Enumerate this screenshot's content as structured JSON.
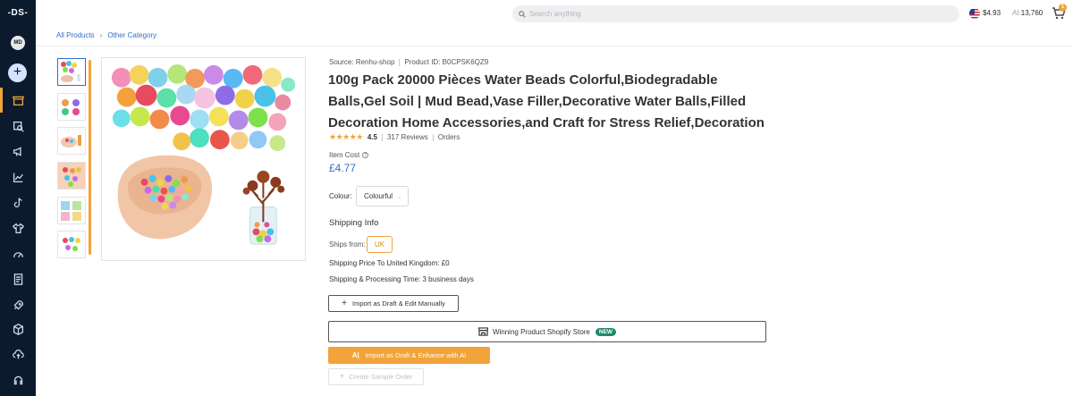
{
  "app": {
    "logo_text": "-DS-",
    "user_initials": "MD",
    "add_label": "+"
  },
  "sidebar": {
    "items": [
      {
        "icon": "store-icon",
        "active": true
      },
      {
        "icon": "product-search-icon",
        "active": false
      },
      {
        "icon": "megaphone-icon",
        "active": false
      },
      {
        "icon": "analytics-icon",
        "active": false
      },
      {
        "icon": "tiktok-icon",
        "active": false
      },
      {
        "icon": "shirt-icon",
        "active": false
      },
      {
        "icon": "speedometer-icon",
        "active": false
      },
      {
        "icon": "orders-icon",
        "active": false
      },
      {
        "icon": "rocket-icon",
        "active": false
      },
      {
        "icon": "package-icon",
        "active": false
      },
      {
        "icon": "cloud-upload-icon",
        "active": false
      },
      {
        "icon": "support-icon",
        "active": false
      }
    ]
  },
  "topbar": {
    "search_placeholder": "Search anything",
    "balance": "$4.93",
    "ai_label": "AI:",
    "ai_credits": "13,760",
    "cart_count": "1"
  },
  "breadcrumb": {
    "items": [
      "All Products",
      "Other Category"
    ]
  },
  "product": {
    "source_label": "Source:",
    "source": "Renhu-shop",
    "product_id_label": "Product ID:",
    "product_id": "B0CPSK6QZ9",
    "title": "100g Pack 20000 Pièces Water Beads Colorful,Biodegradable Balls,Gel Soil | Mud Bead,Vase Filler,Decorative Water Balls,Filled Decoration Home Accessories,and Craft for Stress Relief,Decoration",
    "stars": "★★★★★",
    "rating": "4.5",
    "reviews": "317 Reviews",
    "orders": "Orders",
    "item_cost_label": "Item Cost",
    "price": "£4.77",
    "colour_label": "Colour:",
    "colour_value": "Colourful",
    "thumbnail_count": 6
  },
  "shipping": {
    "heading": "Shipping Info",
    "ships_from_label": "Ships from:",
    "ships_from": "UK",
    "price_line": "Shipping Price To United Kingdom:  £0",
    "time_line": "Shipping & Processing Time:  3 business days"
  },
  "actions": {
    "import_manual": "Import as Draft & Edit Manually",
    "winning_store": "Winning Product Shopify Store",
    "new_badge": "NEW",
    "import_ai": "Import as Draft & Enhance with AI",
    "sample_order": "Create Sample Order"
  },
  "colors": {
    "accent": "#f2a33a",
    "link": "#2f6fc7",
    "sidebar_bg": "#0c1a2e",
    "new_badge": "#1f8a6c"
  }
}
